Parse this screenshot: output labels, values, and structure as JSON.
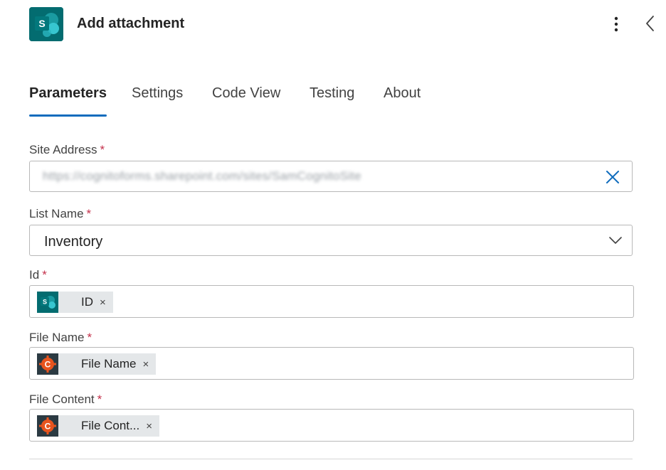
{
  "header": {
    "title": "Add attachment",
    "app_icon": "sharepoint-icon",
    "more_icon": "more-vertical-icon",
    "collapse_icon": "chevron-left-icon"
  },
  "tabs": [
    {
      "label": "Parameters",
      "active": true
    },
    {
      "label": "Settings",
      "active": false
    },
    {
      "label": "Code View",
      "active": false
    },
    {
      "label": "Testing",
      "active": false
    },
    {
      "label": "About",
      "active": false
    }
  ],
  "fields": {
    "site_address": {
      "label": "Site Address",
      "required_mark": "*",
      "value": "https://cognitoforms.sharepoint.com/sites/SamCognitoSite"
    },
    "list_name": {
      "label": "List Name",
      "required_mark": "*",
      "value": "Inventory"
    },
    "id": {
      "label": "Id",
      "required_mark": "*",
      "token": {
        "label": "ID",
        "icon": "sharepoint-icon",
        "remove": "×"
      }
    },
    "file_name": {
      "label": "File Name",
      "required_mark": "*",
      "token": {
        "label": "File Name",
        "icon": "cognito-forms-icon",
        "remove": "×"
      }
    },
    "file_content": {
      "label": "File Content",
      "required_mark": "*",
      "token": {
        "label": "File Cont...",
        "icon": "cognito-forms-icon",
        "remove": "×"
      }
    }
  },
  "colors": {
    "accent": "#0f6cbd",
    "required": "#c4314b",
    "sharepoint": "#036c70",
    "cognito_bg": "#2b3a42",
    "cognito_orange": "#e8541e",
    "token_bg": "#e4e7e9"
  }
}
